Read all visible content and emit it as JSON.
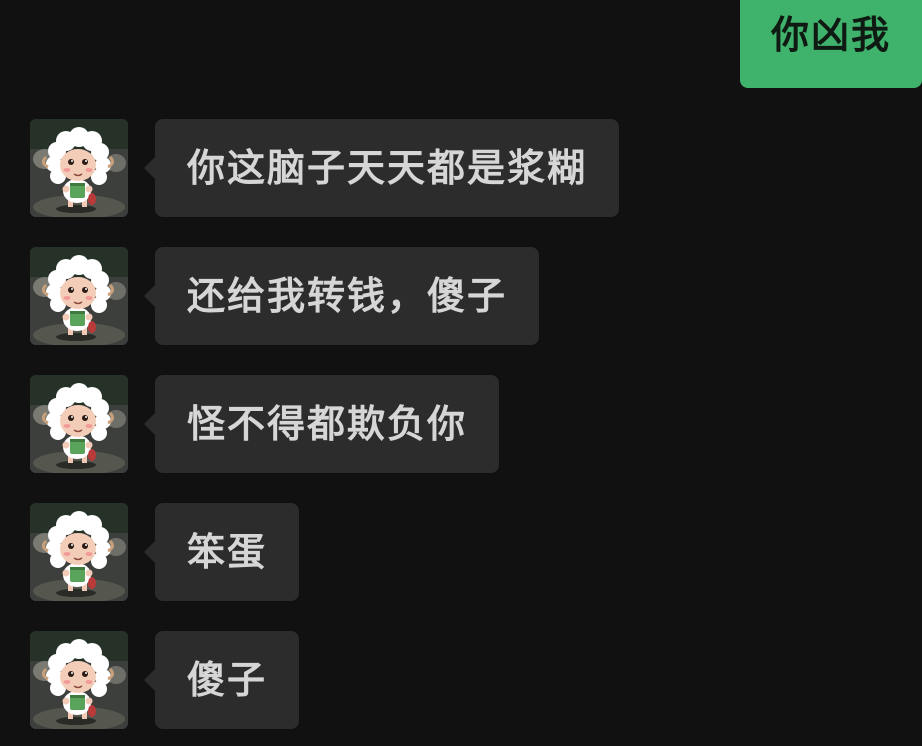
{
  "sent_message": {
    "text": "你凶我",
    "color": "#3fb26c"
  },
  "received_messages": [
    {
      "text": "你这脑子天天都是浆糊",
      "avatar": "sheep-avatar-icon"
    },
    {
      "text": "还给我转钱，傻子",
      "avatar": "sheep-avatar-icon"
    },
    {
      "text": "怪不得都欺负你",
      "avatar": "sheep-avatar-icon"
    },
    {
      "text": "笨蛋",
      "avatar": "sheep-avatar-icon"
    },
    {
      "text": "傻子",
      "avatar": "sheep-avatar-icon"
    }
  ],
  "colors": {
    "background": "#111111",
    "received_bubble": "#2c2c2c",
    "received_text": "#d6d6d6",
    "sent_bubble": "#3fb26c"
  }
}
